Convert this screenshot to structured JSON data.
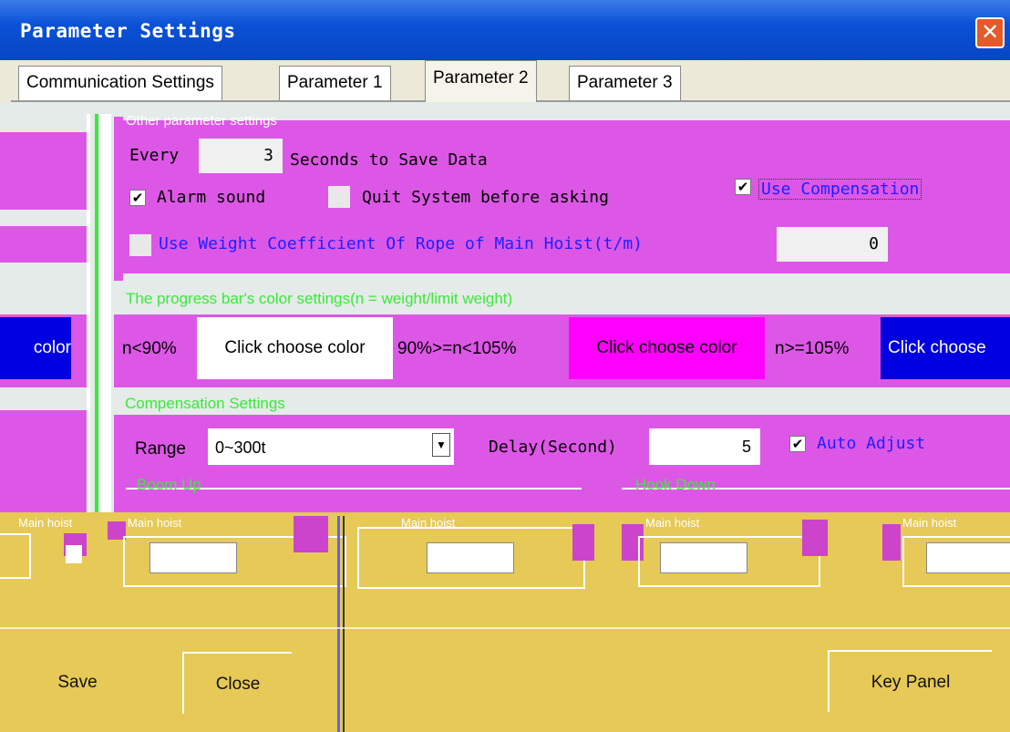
{
  "window": {
    "title": "Parameter Settings",
    "close_symbol": "✕"
  },
  "tabs": [
    "Communication Settings",
    "Parameter 1",
    "Parameter 2",
    "Parameter 3"
  ],
  "active_tab_index": 2,
  "other_params": {
    "caption": "Other parameter settings",
    "every_label": "Every",
    "save_interval": "3",
    "save_suffix": "Seconds to Save Data",
    "alarm_sound_label": "Alarm sound",
    "alarm_sound_checked": true,
    "quit_label": "Quit System before asking",
    "quit_checked": false,
    "compensation_label": "Use Compensation",
    "compensation_checked": true,
    "rope_label": "Use Weight Coefficient Of Rope of Main Hoist(t/m)",
    "rope_checked": false,
    "rope_value": "0"
  },
  "progress_colors": {
    "caption": "The progress bar's color settings(n = weight/limit weight)",
    "left_edge_label": "color",
    "ranges": [
      {
        "label": "n<90%",
        "button": "Click choose color",
        "color": "#ffffff",
        "text_color": "#000000"
      },
      {
        "label": "90%>=n<105%",
        "button": "Click choose color",
        "color": "#ff00ff",
        "text_color": "#000000"
      },
      {
        "label": "n>=105%",
        "button": "Click choose",
        "color": "#0000e0",
        "text_color": "#ffffff"
      }
    ]
  },
  "compensation": {
    "caption": "Compensation Settings",
    "range_label": "Range",
    "range_value": "0~300t",
    "delay_label": "Delay(Second)",
    "delay_value": "5",
    "auto_adjust_label": "Auto Adjust",
    "auto_adjust_checked": true,
    "boom_up_caption": "Boom Up",
    "hook_down_caption": "Hook Down",
    "sub_caption": "Main hoist"
  },
  "footer": {
    "save": "Save",
    "close": "Close",
    "key_panel": "Key Panel"
  },
  "colors": {
    "accent_magenta": "#dd57e6",
    "corrupt_yellow": "#e6c956",
    "titlebar": "#0a51d6"
  }
}
